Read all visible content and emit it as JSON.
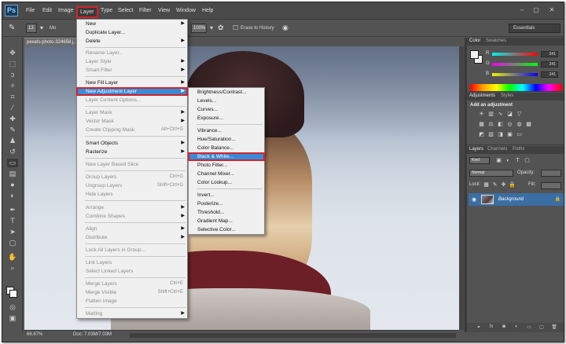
{
  "app_logo": "Ps",
  "menubar": {
    "items": [
      {
        "label": "File"
      },
      {
        "label": "Edit"
      },
      {
        "label": "Image"
      },
      {
        "label": "Layer"
      },
      {
        "label": "Type"
      },
      {
        "label": "Select"
      },
      {
        "label": "Filter"
      },
      {
        "label": "View"
      },
      {
        "label": "Window"
      },
      {
        "label": "Help"
      }
    ],
    "window_controls": [
      "–",
      "▢",
      "✕"
    ]
  },
  "options_bar": {
    "brush_size": "13",
    "mode_prefix": "Mo",
    "flow_value": "100%",
    "erase_to_history": "Erase to History",
    "workspace": "Essentials"
  },
  "document": {
    "tab_title": "pexels-photo-324658.j...",
    "zoom": "66.67%",
    "doc_size": "Doc: 7.03M/7.03M"
  },
  "layer_menu": {
    "items": [
      {
        "label": "New",
        "disabled": false,
        "submenu": true
      },
      {
        "label": "Duplicate Layer...",
        "disabled": false
      },
      {
        "label": "Delete",
        "disabled": false,
        "submenu": true
      },
      {
        "label": "Rename Layer...",
        "disabled": true
      },
      {
        "label": "Layer Style",
        "disabled": true,
        "submenu": true
      },
      {
        "label": "Smart Filter",
        "disabled": true,
        "submenu": true
      },
      {
        "label": "New Fill Layer",
        "disabled": false,
        "submenu": true
      },
      {
        "label": "New Adjustment Layer",
        "disabled": false,
        "submenu": true,
        "highlighted": true
      },
      {
        "label": "Layer Content Options...",
        "disabled": true
      },
      {
        "label": "Layer Mask",
        "disabled": true,
        "submenu": true
      },
      {
        "label": "Vector Mask",
        "disabled": true,
        "submenu": true
      },
      {
        "label": "Create Clipping Mask",
        "disabled": true,
        "shortcut": "Alt+Ctrl+G"
      },
      {
        "label": "Smart Objects",
        "disabled": false,
        "submenu": true
      },
      {
        "label": "Rasterize",
        "disabled": false,
        "submenu": true
      },
      {
        "label": "New Layer Based Slice",
        "disabled": true
      },
      {
        "label": "Group Layers",
        "disabled": true,
        "shortcut": "Ctrl+G"
      },
      {
        "label": "Ungroup Layers",
        "disabled": true,
        "shortcut": "Shift+Ctrl+G"
      },
      {
        "label": "Hide Layers",
        "disabled": true
      },
      {
        "label": "Arrange",
        "disabled": true,
        "submenu": true
      },
      {
        "label": "Combine Shapes",
        "disabled": true,
        "submenu": true
      },
      {
        "label": "Align",
        "disabled": true,
        "submenu": true
      },
      {
        "label": "Distribute",
        "disabled": true,
        "submenu": true
      },
      {
        "label": "Lock All Layers in Group...",
        "disabled": true
      },
      {
        "label": "Link Layers",
        "disabled": true
      },
      {
        "label": "Select Linked Layers",
        "disabled": true
      },
      {
        "label": "Merge Layers",
        "disabled": true,
        "shortcut": "Ctrl+E"
      },
      {
        "label": "Merge Visible",
        "disabled": true,
        "shortcut": "Shift+Ctrl+E"
      },
      {
        "label": "Flatten Image",
        "disabled": true
      },
      {
        "label": "Matting",
        "disabled": true,
        "submenu": true
      }
    ]
  },
  "adjustment_submenu": {
    "items": [
      {
        "label": "Brightness/Contrast..."
      },
      {
        "label": "Levels..."
      },
      {
        "label": "Curves..."
      },
      {
        "label": "Exposure..."
      },
      {
        "label": "Vibrance..."
      },
      {
        "label": "Hue/Saturation..."
      },
      {
        "label": "Color Balance..."
      },
      {
        "label": "Black & White...",
        "highlighted": true
      },
      {
        "label": "Photo Filter..."
      },
      {
        "label": "Channel Mixer..."
      },
      {
        "label": "Color Lookup..."
      },
      {
        "label": "Invert..."
      },
      {
        "label": "Posterize..."
      },
      {
        "label": "Threshold..."
      },
      {
        "label": "Gradient Map..."
      },
      {
        "label": "Selective Color..."
      }
    ]
  },
  "color_panel": {
    "tabs": [
      "Color",
      "Swatches"
    ],
    "channels": [
      {
        "label": "R",
        "value": "241"
      },
      {
        "label": "G",
        "value": "241"
      },
      {
        "label": "B",
        "value": "241"
      }
    ]
  },
  "adjustments_panel": {
    "tabs": [
      "Adjustments",
      "Styles"
    ],
    "title": "Add an adjustment"
  },
  "layers_panel": {
    "tabs": [
      "Layers",
      "Channels",
      "Paths"
    ],
    "kind": "Kind",
    "blend_mode": "Normal",
    "opacity_label": "Opacity:",
    "lock_label": "Lock:",
    "fill_label": "Fill:",
    "layer_name": "Background"
  },
  "colors": {
    "accent": "#3a8ad8",
    "highlight_border": "#d4232b",
    "panel_bg": "#535353"
  }
}
